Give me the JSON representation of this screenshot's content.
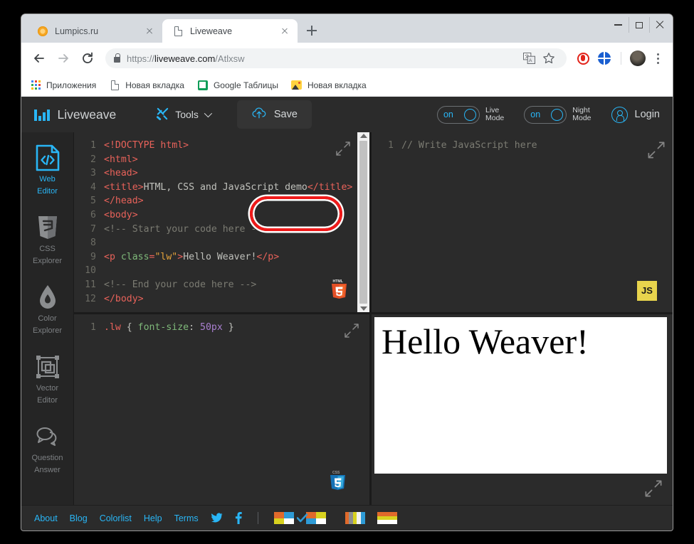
{
  "browser": {
    "tabs": [
      {
        "title": "Lumpics.ru",
        "favicon": "orange-circle-icon",
        "active": false
      },
      {
        "title": "Liveweave",
        "favicon": "document-icon",
        "active": true
      }
    ],
    "new_tab_label": "+",
    "window_controls": {
      "minimize": "minimize-icon",
      "maximize": "maximize-icon",
      "close": "close-icon"
    },
    "nav": {
      "back": "back-arrow-icon",
      "forward": "forward-arrow-icon",
      "reload": "reload-icon"
    },
    "omnibox": {
      "lock": "lock-icon",
      "url_scheme": "https://",
      "url_host": "liveweave.com",
      "url_path": "/Atlxsw",
      "full_url": "https://liveweave.com/Atlxsw"
    },
    "omnibox_actions": [
      "translate-icon",
      "bookmark-star-icon"
    ],
    "extensions": [
      "opera-shield-icon",
      "blue-globe-icon"
    ],
    "profile": "avatar",
    "menu": "kebab-menu-icon",
    "bookmarks": [
      {
        "label": "Приложения",
        "icon": "apps-grid-icon"
      },
      {
        "label": "Новая вкладка",
        "icon": "document-icon"
      },
      {
        "label": "Google Таблицы",
        "icon": "google-sheets-icon"
      },
      {
        "label": "Новая вкладка",
        "icon": "image-icon"
      }
    ]
  },
  "app": {
    "brand": "Liveweave",
    "tools_label": "Tools",
    "save_label": "Save",
    "save_icon": "cloud-upload-icon",
    "toggles": [
      {
        "state": "on",
        "label_line1": "Live",
        "label_line2": "Mode"
      },
      {
        "state": "on",
        "label_line1": "Night",
        "label_line2": "Mode"
      }
    ],
    "login_label": "Login",
    "login_icon": "user-circle-icon",
    "annotation": {
      "target": "save-button",
      "color": "#f01a1a"
    },
    "sidebar": [
      {
        "line1": "Web",
        "line2": "Editor",
        "icon": "code-file-icon",
        "active": true
      },
      {
        "line1": "CSS",
        "line2": "Explorer",
        "icon": "css3-shield-icon",
        "active": false
      },
      {
        "line1": "Color",
        "line2": "Explorer",
        "icon": "droplet-icon",
        "active": false
      },
      {
        "line1": "Vector",
        "line2": "Editor",
        "icon": "vector-shapes-icon",
        "active": false
      },
      {
        "line1": "Question",
        "line2": "Answer",
        "icon": "speech-bubbles-icon",
        "active": false
      }
    ],
    "panes": {
      "html": {
        "badge": "HTML5",
        "expand_icon": "expand-arrows-icon",
        "scrollbar": true,
        "lines": [
          {
            "n": "1",
            "tokens": [
              {
                "t": "tag",
                "s": "<!DOCTYPE html>"
              }
            ]
          },
          {
            "n": "2",
            "tokens": [
              {
                "t": "tag",
                "s": "<html>"
              }
            ]
          },
          {
            "n": "3",
            "tokens": [
              {
                "t": "tag",
                "s": "<head>"
              }
            ]
          },
          {
            "n": "4",
            "tokens": [
              {
                "t": "tag",
                "s": "<title>"
              },
              {
                "t": "plain",
                "s": "HTML, CSS and JavaScript demo"
              },
              {
                "t": "tag",
                "s": "</title>"
              }
            ]
          },
          {
            "n": "5",
            "tokens": [
              {
                "t": "tag",
                "s": "</head>"
              }
            ]
          },
          {
            "n": "6",
            "tokens": [
              {
                "t": "tag",
                "s": "<body>"
              }
            ]
          },
          {
            "n": "7",
            "tokens": [
              {
                "t": "com",
                "s": "<!-- Start your code here -->"
              }
            ]
          },
          {
            "n": "8",
            "tokens": [
              {
                "t": "plain",
                "s": ""
              }
            ]
          },
          {
            "n": "9",
            "tokens": [
              {
                "t": "tag",
                "s": "<p "
              },
              {
                "t": "attr",
                "s": "class"
              },
              {
                "t": "tag",
                "s": "="
              },
              {
                "t": "str",
                "s": "\"lw\""
              },
              {
                "t": "tag",
                "s": ">"
              },
              {
                "t": "plain",
                "s": "Hello Weaver!"
              },
              {
                "t": "tag",
                "s": "</p>"
              }
            ]
          },
          {
            "n": "10",
            "tokens": [
              {
                "t": "plain",
                "s": ""
              }
            ]
          },
          {
            "n": "11",
            "tokens": [
              {
                "t": "com",
                "s": "<!-- End your code here -->"
              }
            ]
          },
          {
            "n": "12",
            "tokens": [
              {
                "t": "tag",
                "s": "</body>"
              }
            ]
          }
        ]
      },
      "css": {
        "badge": "CSS3",
        "expand_icon": "expand-arrows-icon",
        "lines": [
          {
            "n": "1",
            "tokens": [
              {
                "t": "sel",
                "s": ".lw"
              },
              {
                "t": "plain",
                "s": " { "
              },
              {
                "t": "prop",
                "s": "font-size"
              },
              {
                "t": "plain",
                "s": ": "
              },
              {
                "t": "val",
                "s": "50px"
              },
              {
                "t": "plain",
                "s": " }"
              }
            ]
          }
        ]
      },
      "js": {
        "badge": "JS",
        "expand_icon": "expand-arrows-icon",
        "lines": [
          {
            "n": "1",
            "tokens": [
              {
                "t": "com",
                "s": "// Write JavaScript here"
              }
            ]
          }
        ]
      },
      "preview": {
        "text": "Hello Weaver!",
        "expand_icon": "expand-arrows-icon"
      }
    },
    "footer": {
      "links": [
        "About",
        "Blog",
        "Colorlist",
        "Help",
        "Terms"
      ],
      "social": [
        "twitter-icon",
        "facebook-icon"
      ],
      "swatches": [
        [
          "#e06a2b",
          "#2e9bd6",
          "#d8d21f",
          "#ffffff"
        ],
        [
          "#e06a2b",
          "#d8d21f",
          "#2e9bd6",
          "#ffffff"
        ],
        [
          "#e06a2b",
          "#2e9bd6",
          "#d8d21f",
          "#e8e8e8"
        ],
        [
          "#e06a2b",
          "#d8d21f",
          "#ffffff",
          "#ffffff"
        ]
      ]
    }
  },
  "colors": {
    "accent": "#29b6f6",
    "annotation_red": "#f01a1a",
    "editor_bg": "#2b2b2b",
    "app_bg": "#222222",
    "js_badge": "#e8d44d"
  }
}
